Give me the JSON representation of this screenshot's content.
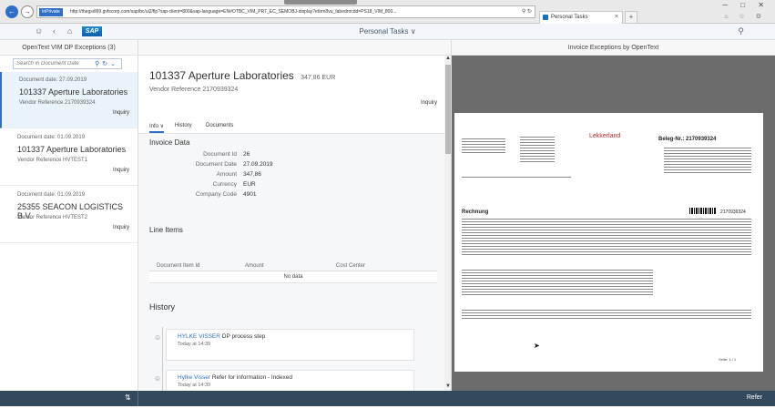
{
  "browser": {
    "inprivate": "InPrivate",
    "url": "http://thegsdl99.gvfscorp.com/sap/bc/ui2/flp?sap-client=800&sap-language=EN#OTBC_VIM_PR7_EC_SEMOBJ-display?ettrm8vu_fabedrocdd=PS18_VIM_800...",
    "tab_title": "Personal Tasks",
    "new_tab": "+",
    "window_controls": "─ □ ✕",
    "tray": "⌂ ☆ ⚙"
  },
  "shell": {
    "logo": "SAP",
    "title": "Personal Tasks  ∨",
    "icons": {
      "user": "user-icon",
      "back": "back-icon",
      "home": "home-icon",
      "search": "search-icon"
    }
  },
  "master": {
    "title": "OpenText VIM DP Exceptions (3)",
    "search_placeholder": "Search in Document Date",
    "items": [
      {
        "date": "Document date: 27.09.2019",
        "name": "101337 Aperture Laboratories",
        "ref": "Vendor Reference 2170939324",
        "status": "Inquiry"
      },
      {
        "date": "Document date: 01.09.2019",
        "name": "101337 Aperture Laboratories",
        "ref": "Vendor Reference HVTEST1",
        "status": "Inquiry"
      },
      {
        "date": "Document date: 01.09.2019",
        "name": "25355 SEACON LOGISTICS B.V.",
        "ref": "Vendor Reference HVTEST2",
        "status": "Inquiry"
      }
    ]
  },
  "detail": {
    "title": "101337 Aperture Laboratories",
    "amount": "347,86 EUR",
    "vendor_ref": "Vendor Reference 2170939324",
    "status": "Inquiry",
    "tabs": [
      "Info ∨",
      "History",
      "Documents"
    ],
    "invoice_data_title": "Invoice Data",
    "fields": [
      {
        "label": "Document Id",
        "value": "26"
      },
      {
        "label": "Document Date",
        "value": "27.09.2019"
      },
      {
        "label": "Amount",
        "value": "347,86"
      },
      {
        "label": "Currency",
        "value": "EUR"
      },
      {
        "label": "Company Code",
        "value": "4901"
      }
    ],
    "line_items_title": "Line Items",
    "line_items_columns": [
      "Document Item Id",
      "Amount",
      "Cost Center"
    ],
    "line_items_empty": "No data",
    "history_title": "History",
    "history": [
      {
        "user": "HYLKE VISSER",
        "text": " DP process step",
        "time": "Today at 14:39"
      },
      {
        "user": "Hylke Visser",
        "text": " Refer for information - Indexed",
        "time": "Today at 14:39"
      }
    ]
  },
  "preview": {
    "title": "Invoice Exceptions by OpenText",
    "logo_text": "Lekkerland",
    "beleg_nr": "Beleg-Nr.: 2170939324",
    "rechnung": "Rechnung",
    "doc_no": "2170939324",
    "page_no": "Seite: 1 / 1"
  },
  "footer": {
    "refer_label": "Refer"
  }
}
